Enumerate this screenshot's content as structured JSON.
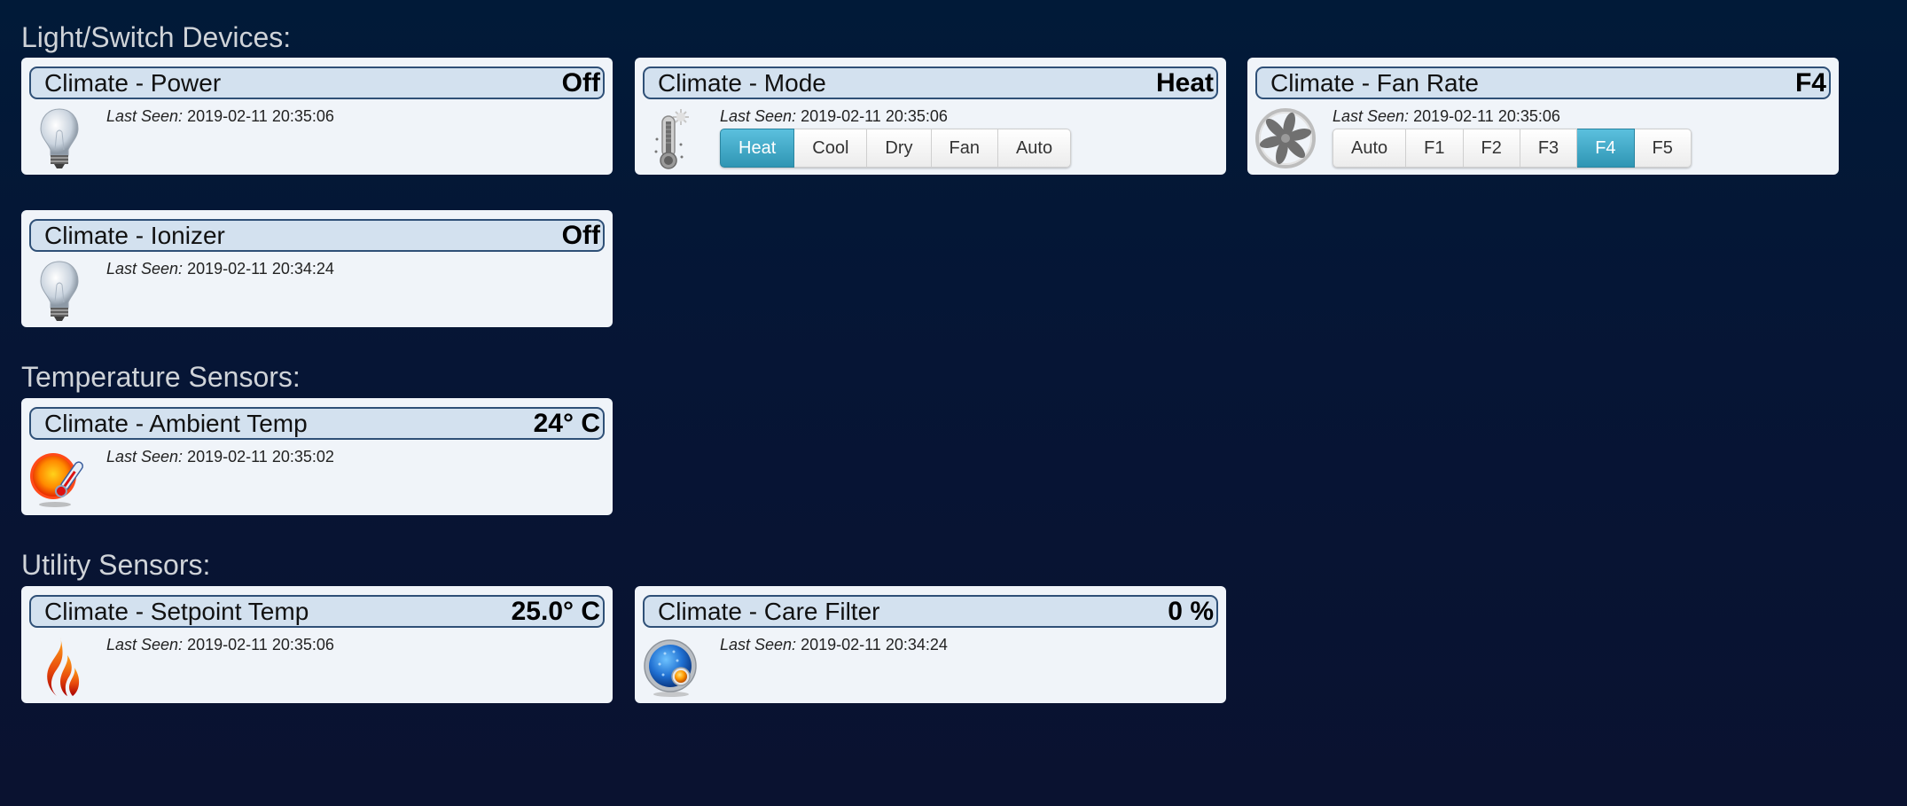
{
  "sections": [
    {
      "title": "Light/Switch Devices:",
      "devices": [
        {
          "title": "Climate - Power",
          "state": "Off",
          "icon": "light-bulb-icon",
          "last_seen_label": "Last Seen:",
          "last_seen": "2019-02-11 20:35:06"
        },
        {
          "title": "Climate - Mode",
          "state": "Heat",
          "icon": "thermometer-sun-icon",
          "last_seen_label": "Last Seen:",
          "last_seen": "2019-02-11 20:35:06",
          "options": [
            "Heat",
            "Cool",
            "Dry",
            "Fan",
            "Auto"
          ],
          "selected": "Heat"
        },
        {
          "title": "Climate - Fan Rate",
          "state": "F4",
          "icon": "fan-icon",
          "last_seen_label": "Last Seen:",
          "last_seen": "2019-02-11 20:35:06",
          "options": [
            "Auto",
            "F1",
            "F2",
            "F3",
            "F4",
            "F5"
          ],
          "selected": "F4"
        },
        {
          "title": "Climate - Ionizer",
          "state": "Off",
          "icon": "light-bulb-icon",
          "last_seen_label": "Last Seen:",
          "last_seen": "2019-02-11 20:34:24"
        }
      ]
    },
    {
      "title": "Temperature Sensors:",
      "devices": [
        {
          "title": "Climate - Ambient Temp",
          "state": "24° C",
          "icon": "sun-thermometer-icon",
          "last_seen_label": "Last Seen:",
          "last_seen": "2019-02-11 20:35:02"
        }
      ]
    },
    {
      "title": "Utility Sensors:",
      "devices": [
        {
          "title": "Climate - Setpoint Temp",
          "state": "25.0° C",
          "icon": "flame-icon",
          "last_seen_label": "Last Seen:",
          "last_seen": "2019-02-11 20:35:06"
        },
        {
          "title": "Climate - Care Filter",
          "state": "0 %",
          "icon": "gauge-dial-icon",
          "last_seen_label": "Last Seen:",
          "last_seen": "2019-02-11 20:34:24"
        }
      ]
    }
  ],
  "colors": {
    "active_button": "#2f96b4",
    "header_bar": "#d3e1ef",
    "header_border": "#2f5077",
    "card_bg": "#f0f4f9"
  }
}
